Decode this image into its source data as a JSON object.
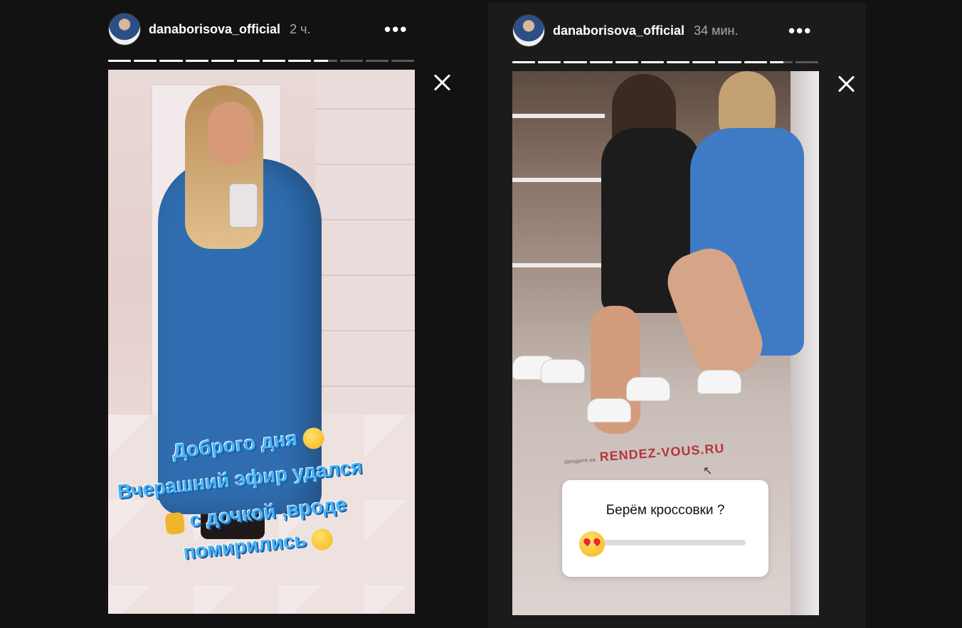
{
  "stories": [
    {
      "username": "danaborisova_official",
      "time": "2 ч.",
      "more_label": "•••",
      "progress": {
        "total": 12,
        "done": 8,
        "current_fraction": 0.6
      },
      "caption": {
        "line1": "Доброго дня",
        "line2": "Вчерашний эфир удался",
        "line3": "с дочкой ,вроде",
        "line4": "помирились"
      },
      "icons": [
        "avatar",
        "more-icon",
        "close-icon",
        "kiss-emoji",
        "thumbs-up-emoji",
        "zany-face-emoji"
      ]
    },
    {
      "username": "danaborisova_official",
      "time": "34 мин.",
      "more_label": "•••",
      "progress": {
        "total": 12,
        "done": 10,
        "current_fraction": 0.5
      },
      "watermark": {
        "prefix": "заходите на",
        "site": "RENDEZ-VOUS.RU"
      },
      "poll": {
        "question": "Берём кроссовки ?",
        "emoji": "heart-eyes-emoji",
        "value": 0.0
      },
      "icons": [
        "avatar",
        "more-icon",
        "close-icon",
        "cursor-icon"
      ]
    }
  ],
  "colors": {
    "background": "#121212",
    "caption_blue": "#4ab4f5",
    "coat_blue": "#2f6db0",
    "watermark_red": "#b4353d"
  }
}
